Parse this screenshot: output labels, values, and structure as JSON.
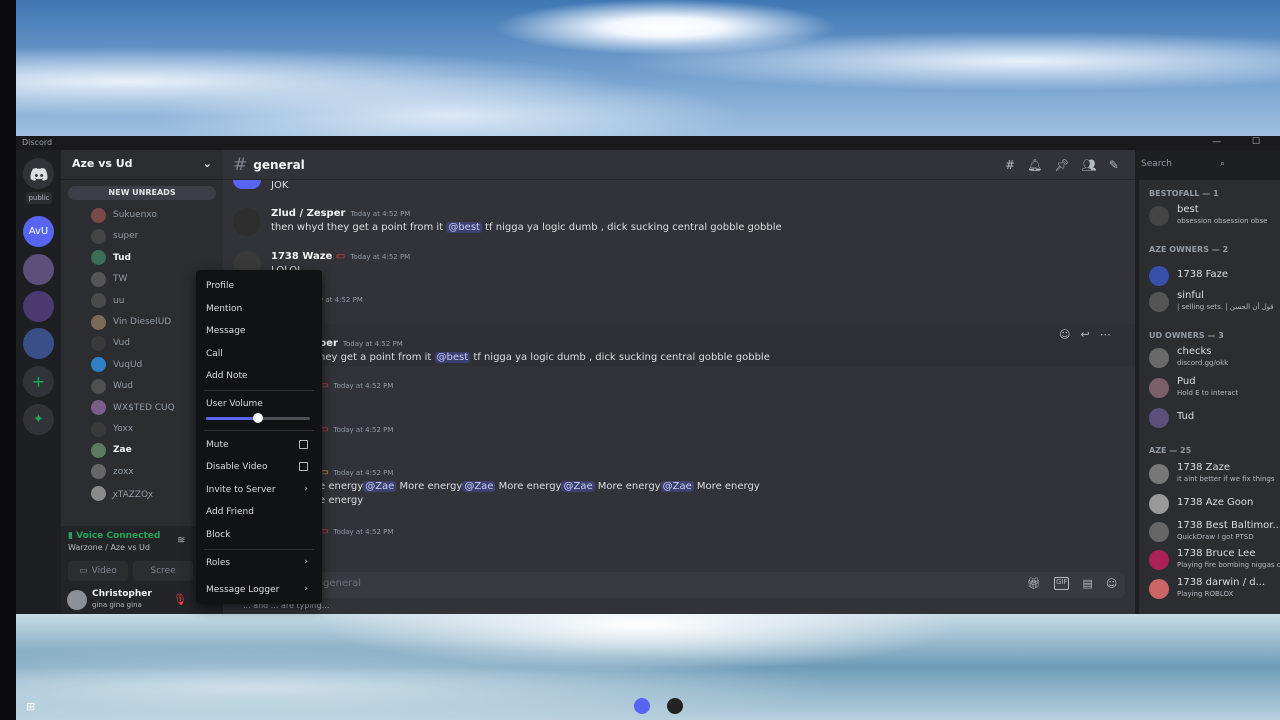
{
  "window": {
    "app_title": "Discord"
  },
  "guilds": {
    "public_label": "public",
    "current_server_abbr": "AvU"
  },
  "server": {
    "name": "Aze vs Ud",
    "new_unreads": "NEW UNREADS"
  },
  "voice_members": [
    {
      "name": "Sukuenxo",
      "active": false
    },
    {
      "name": "super",
      "active": false
    },
    {
      "name": "Tud",
      "active": true
    },
    {
      "name": "TW",
      "active": false
    },
    {
      "name": "uu",
      "active": false
    },
    {
      "name": "Vin DieselUD",
      "active": false
    },
    {
      "name": "Vud",
      "active": false
    },
    {
      "name": "VuqUd",
      "active": false
    },
    {
      "name": "Wud",
      "active": false
    },
    {
      "name": "WX$TED CUQ",
      "active": false
    },
    {
      "name": "Yoxx",
      "active": false
    },
    {
      "name": "Zae",
      "active": true
    },
    {
      "name": "zoxx",
      "active": false
    },
    {
      "name": "ꭙTAZZOꭙ",
      "active": false
    }
  ],
  "voice": {
    "status": "Voice Connected",
    "location": "Warzone / Aze vs Ud",
    "video_label": "Video",
    "screen_label": "Scree"
  },
  "user": {
    "name": "Christopher",
    "status": "gina gina gina"
  },
  "chat": {
    "channel": "general",
    "search_placeholder": "Search",
    "composer_placeholder": "general",
    "typing": "... and ... are typing...",
    "messages": [
      {
        "user": "",
        "time": "",
        "text": "JOK"
      },
      {
        "user": "Zlud / Zesper",
        "time": "Today at 4:52 PM",
        "pre": "then whyd they get a point from it ",
        "mention": "@best",
        "post": " tf nigga ya logic dumb , dick sucking central gobble gobble"
      },
      {
        "user": "1738 Waze",
        "time": "Today at 4:52 PM",
        "text": "LOLOL"
      },
      {
        "user": "",
        "time": "y at 4:52 PM",
        "text": ""
      },
      {
        "user": "per",
        "time": "Today at 4:52 PM",
        "pre": "hey get a point from it ",
        "mention": "@best",
        "post": " tf nigga ya logic dumb , dick sucking central gobble gobble"
      },
      {
        "user": "",
        "time": "Today at 4:52 PM",
        "text": ""
      },
      {
        "user": "",
        "time": "Today at 4:52 PM",
        "text": ""
      },
      {
        "user": "",
        "time": "Today at 4:52 PM",
        "text": ""
      },
      {
        "user": "",
        "time": "Today at 4:52 PM",
        "text": ""
      }
    ],
    "energy_line": {
      "pre": "e energy",
      "mention": "@Zae",
      "more": " More energy",
      "line2": "e energy"
    }
  },
  "members": {
    "categories": [
      {
        "label": "BESTOFALL — 1"
      },
      {
        "label": "AZE OWNERS — 2"
      },
      {
        "label": "UD OWNERS — 3"
      },
      {
        "label": "AZE — 25"
      }
    ],
    "list": [
      {
        "name": "best",
        "status": "obsession obsession obse"
      },
      {
        "name": "1738 Faze",
        "status": ""
      },
      {
        "name": "sinful",
        "status": "| selling sets. | قول أن الحسن"
      },
      {
        "name": "checks",
        "status": "discord.gg/okk"
      },
      {
        "name": "Pud",
        "status": "Hold E to interact"
      },
      {
        "name": "Tud",
        "status": ""
      },
      {
        "name": "1738 Zaze",
        "status": "it aint better if we fix things"
      },
      {
        "name": "1738 Aze Goon",
        "status": ""
      },
      {
        "name": "1738 Best Baltimor...",
        "status": "QuickDraw I got PTSD"
      },
      {
        "name": "1738 Bruce Lee",
        "status": "Playing fire bombing niggas cr"
      },
      {
        "name": "1738 darwin / d...",
        "status": "Playing ROBLOX"
      }
    ]
  },
  "context_menu": {
    "items": [
      "Profile",
      "Mention",
      "Message",
      "Call",
      "Add Note",
      "User Volume",
      "Mute",
      "Disable Video",
      "Invite to Server",
      "Add Friend",
      "Block",
      "Roles",
      "Message Logger"
    ],
    "volume_level": 0.5
  },
  "colors": {
    "accent": "#5865f2",
    "online": "#23a559",
    "mention_bg": "#3c4270"
  }
}
